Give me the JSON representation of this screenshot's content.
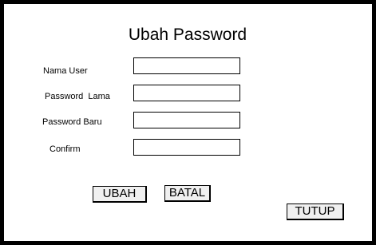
{
  "dialog": {
    "title": "Ubah Password",
    "fields": [
      {
        "label": "Nama User",
        "value": ""
      },
      {
        "label": "Password  Lama",
        "value": ""
      },
      {
        "label": "Password Baru",
        "value": ""
      },
      {
        "label": "Confirm",
        "value": ""
      }
    ],
    "buttons": {
      "ubah": "UBAH",
      "batal": "BATAL",
      "tutup": "TUTUP"
    }
  }
}
